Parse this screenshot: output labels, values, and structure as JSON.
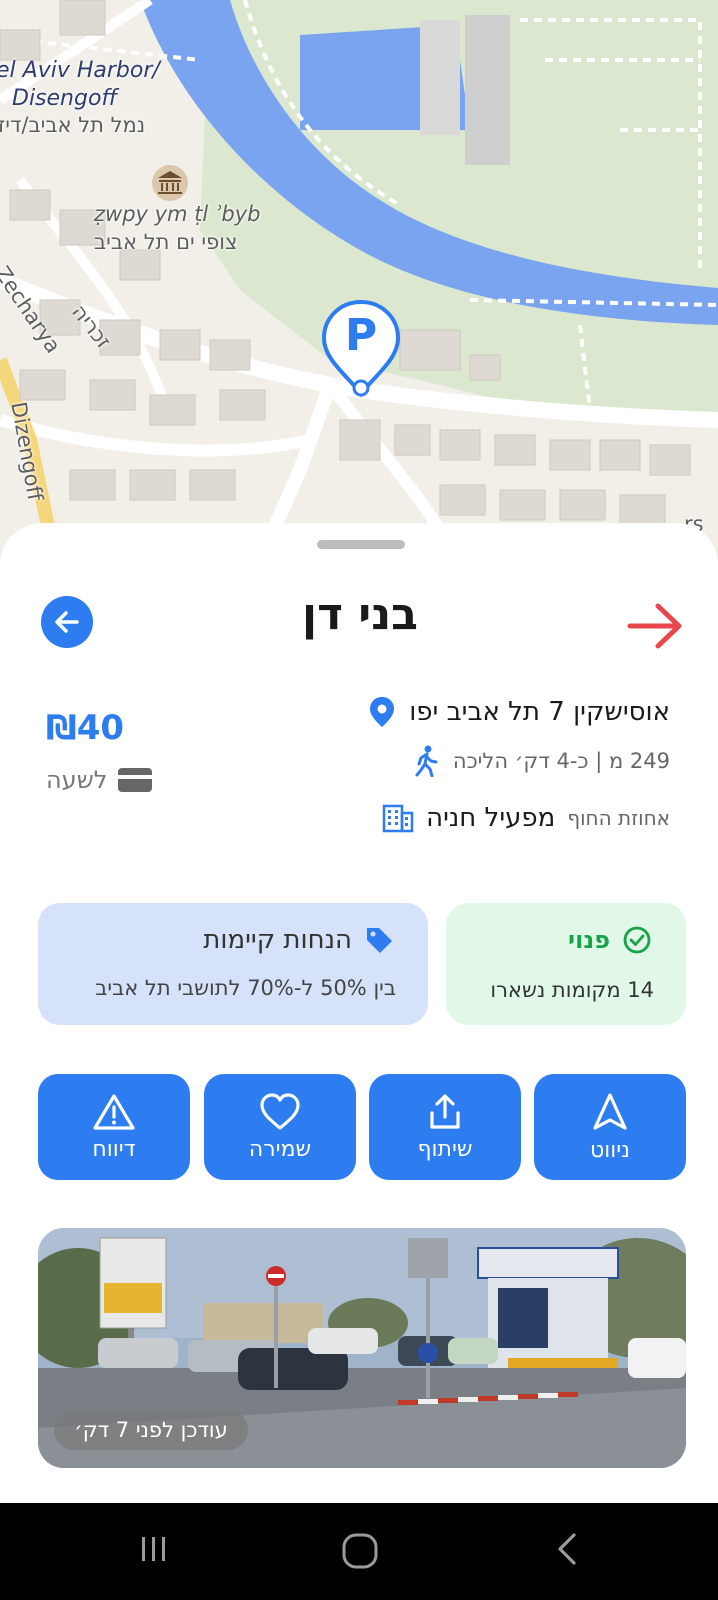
{
  "map": {
    "labels": {
      "harbor_en_1": "el Aviv Harbor/",
      "harbor_en_2": "Disengoff",
      "harbor_he": "נמל תל אביב/דיז",
      "museum_translit": "ẓwpy ym ṭl ʾbyb",
      "museum_he": "צופי ים תל אביב",
      "street_zecharya_en": "Zecharya",
      "street_zecharya_he": "זכריה",
      "street_dizengoff": "Dizengoff",
      "street_partial": "rs"
    },
    "pin_letter": "P"
  },
  "sheet": {
    "title": "בני דן",
    "price": "₪40",
    "per_hour": "לשעה",
    "address": "אוסישקין 7 תל אביב יפו",
    "walk_info": "249 מ | כ-4 דק׳ הליכה",
    "operator_label": "מפעיל חניה",
    "operator_name": "אחוזת החוף",
    "discount": {
      "title": "הנחות קיימות",
      "subtitle": "בין 50% ל-70% לתושבי תל אביב"
    },
    "status": {
      "title": "פנוי",
      "subtitle": "14 מקומות נשארו"
    },
    "actions": {
      "navigate": "ניווט",
      "share": "שיתוף",
      "save": "שמירה",
      "report": "דיווח"
    },
    "photo_updated": "עודכן לפני 7 דק׳"
  },
  "colors": {
    "accent": "#2d7cf0",
    "status_green": "#16a34a",
    "forward_arrow": "#e8474c",
    "water": "#7aa3f0",
    "park": "#dbe8cf"
  },
  "icons": {
    "back": "arrow-left-icon",
    "forward": "arrow-right-icon",
    "location": "location-pin-icon",
    "walk": "walking-icon",
    "building": "building-icon",
    "card": "credit-card-icon",
    "tag": "tag-icon",
    "check": "check-circle-icon",
    "navigate": "navigation-arrow-icon",
    "share": "share-icon",
    "save": "heart-icon",
    "report": "warning-icon",
    "museum": "museum-icon"
  }
}
